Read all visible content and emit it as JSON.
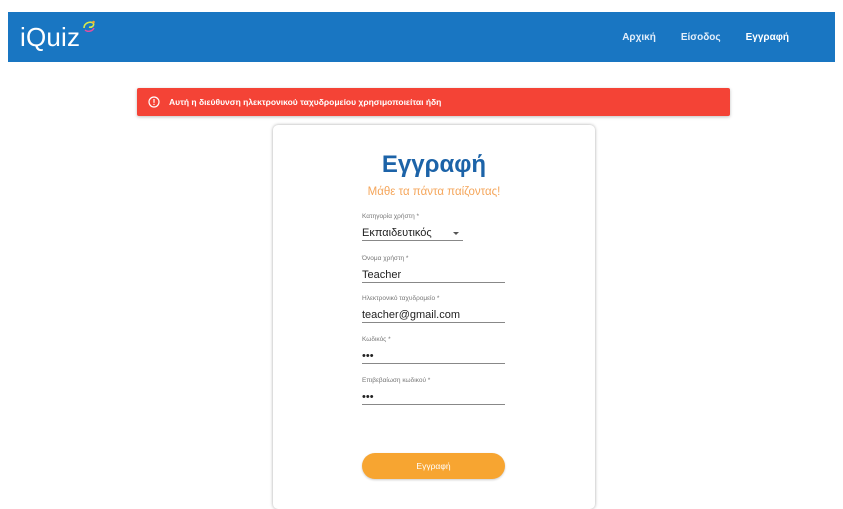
{
  "app": {
    "logo_text": "iQuiz"
  },
  "nav": {
    "items": [
      {
        "label": "Αρχική"
      },
      {
        "label": "Είσοδος"
      },
      {
        "label": "Εγγραφή",
        "active": true
      }
    ]
  },
  "alert": {
    "icon": "error-circle-icon",
    "message": "Αυτή η διεύθυνση ηλεκτρονικού ταχυδρομείου χρησιμοποιείται ήδη"
  },
  "form": {
    "title": "Εγγραφή",
    "subtitle": "Μάθε τα πάντα παίζοντας!",
    "fields": [
      {
        "label": "Κατηγορία χρήστη *",
        "value": "Εκπαιδευτικός",
        "type": "select"
      },
      {
        "label": "Όνομα χρήστη *",
        "value": "Teacher",
        "type": "text"
      },
      {
        "label": "Ηλεκτρονικό ταχυδρομείο *",
        "value": "teacher@gmail.com",
        "type": "email"
      },
      {
        "label": "Κωδικός *",
        "value": "•••",
        "type": "password"
      },
      {
        "label": "Επιβεβαίωση κωδικού *",
        "value": "•••",
        "type": "password"
      }
    ],
    "submit_label": "Εγγραφή"
  },
  "colors": {
    "header_bg": "#1976c2",
    "alert_bg": "#f44336",
    "title": "#1c63a8",
    "subtitle": "#f5a65b",
    "button": "#f7a531"
  }
}
